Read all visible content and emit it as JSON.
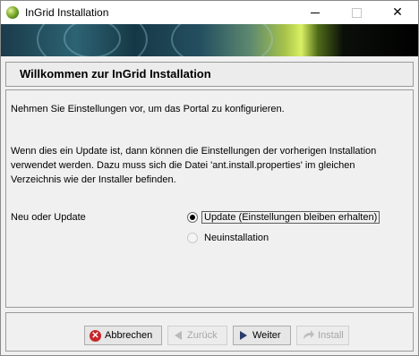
{
  "window": {
    "title": "InGrid Installation"
  },
  "header": {
    "title": "Willkommen zur InGrid Installation"
  },
  "main": {
    "intro": "Nehmen Sie Einstellungen vor, um das Portal zu konfigurieren.",
    "info": "Wenn dies ein Update ist, dann können die Einstellungen der vorherigen Installation verwendet werden. Dazu muss sich die Datei 'ant.install.properties' im gleichen Verzeichnis wie der Installer befinden.",
    "mode_label": "Neu oder Update",
    "options": [
      {
        "label": "Update (Einstellungen bleiben erhalten)",
        "selected": true
      },
      {
        "label": "Neuinstallation",
        "selected": false
      }
    ]
  },
  "footer": {
    "cancel_label": "Abbrechen",
    "back_label": "Zurück",
    "next_label": "Weiter",
    "install_label": "Install"
  }
}
